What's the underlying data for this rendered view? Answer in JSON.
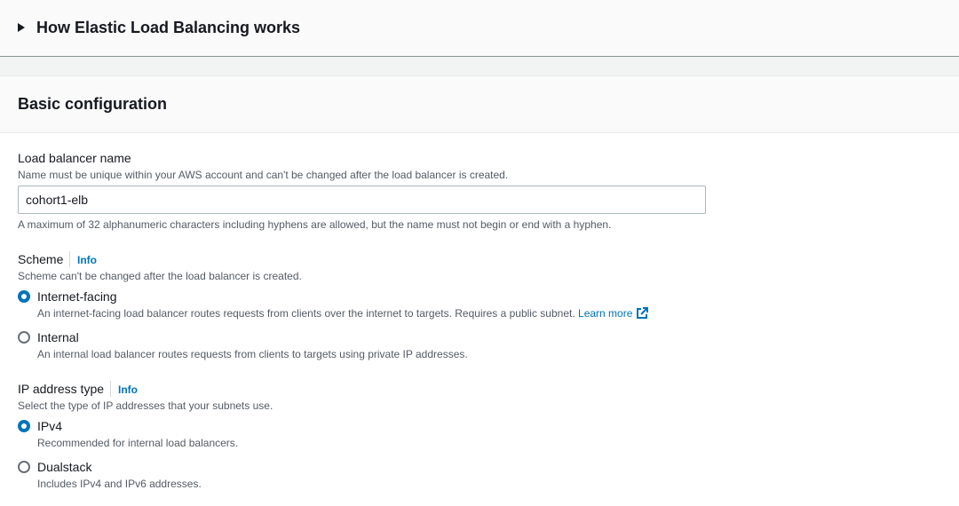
{
  "expander": {
    "title": "How Elastic Load Balancing works"
  },
  "basic_config": {
    "heading": "Basic configuration",
    "name_field": {
      "label": "Load balancer name",
      "description": "Name must be unique within your AWS account and can't be changed after the load balancer is created.",
      "value": "cohort1-elb",
      "constraint": "A maximum of 32 alphanumeric characters including hyphens are allowed, but the name must not begin or end with a hyphen."
    },
    "scheme": {
      "label": "Scheme",
      "info": "Info",
      "description": "Scheme can't be changed after the load balancer is created.",
      "options": [
        {
          "label": "Internet-facing",
          "description": "An internet-facing load balancer routes requests from clients over the internet to targets. Requires a public subnet.",
          "link": "Learn more",
          "selected": true
        },
        {
          "label": "Internal",
          "description": "An internal load balancer routes requests from clients to targets using private IP addresses.",
          "selected": false
        }
      ]
    },
    "ip_type": {
      "label": "IP address type",
      "info": "Info",
      "description": "Select the type of IP addresses that your subnets use.",
      "options": [
        {
          "label": "IPv4",
          "description": "Recommended for internal load balancers.",
          "selected": true
        },
        {
          "label": "Dualstack",
          "description": "Includes IPv4 and IPv6 addresses.",
          "selected": false
        }
      ]
    }
  },
  "colors": {
    "accent": "#0073bb",
    "text": "#16191f",
    "muted": "#545b64",
    "border": "#aab7b8"
  }
}
